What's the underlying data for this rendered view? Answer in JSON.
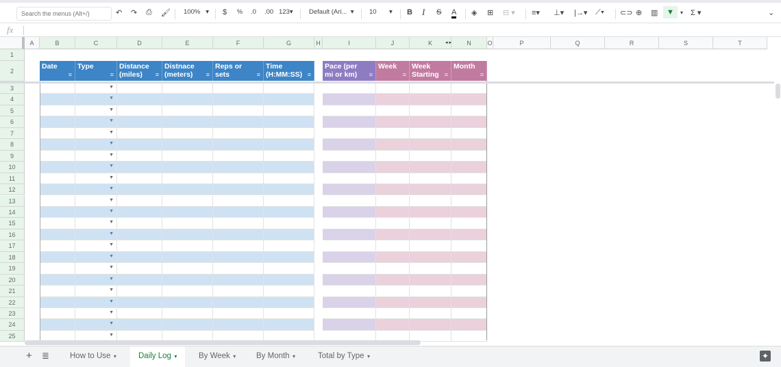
{
  "toolbar": {
    "search_placeholder": "Search the menus (Alt+/)",
    "zoom": "100%",
    "currency": "$",
    "percent": "%",
    "dec_less": ".0",
    "dec_more": ".00",
    "format": "123",
    "font": "Default (Ari...",
    "font_size": "10",
    "bold": "B",
    "italic": "I",
    "strike": "S",
    "text_color": "A",
    "sum": "Σ"
  },
  "formula_bar": {
    "label": "fx",
    "value": ""
  },
  "columns": [
    {
      "letter": "A",
      "w": 22
    },
    {
      "letter": "B",
      "w": 52
    },
    {
      "letter": "C",
      "w": 61
    },
    {
      "letter": "D",
      "w": 66
    },
    {
      "letter": "E",
      "w": 74
    },
    {
      "letter": "F",
      "w": 74
    },
    {
      "letter": "G",
      "w": 74
    },
    {
      "letter": "H",
      "w": 12
    },
    {
      "letter": "I",
      "w": 78
    },
    {
      "letter": "J",
      "w": 49
    },
    {
      "letter": "K",
      "w": 61
    },
    {
      "letter": "N",
      "w": 52
    },
    {
      "letter": "O",
      "w": 9
    },
    {
      "letter": "P",
      "w": 84
    },
    {
      "letter": "Q",
      "w": 79
    },
    {
      "letter": "R",
      "w": 79
    },
    {
      "letter": "S",
      "w": 79
    },
    {
      "letter": "T",
      "w": 79
    }
  ],
  "rows": [
    "1",
    "2",
    "3",
    "4",
    "5",
    "6",
    "7",
    "8",
    "9",
    "10",
    "11",
    "12",
    "13",
    "14",
    "15",
    "16",
    "17",
    "18",
    "19",
    "20",
    "21",
    "22",
    "23",
    "24",
    "25"
  ],
  "headers": [
    {
      "col": "B",
      "line1": "",
      "line2": "Date",
      "group": "blue"
    },
    {
      "col": "C",
      "line1": "",
      "line2": "Type",
      "group": "blue"
    },
    {
      "col": "D",
      "line1": "Distance",
      "line2": "(miles)",
      "group": "blue"
    },
    {
      "col": "E",
      "line1": "Distnace",
      "line2": "(meters)",
      "group": "blue"
    },
    {
      "col": "F",
      "line1": "Reps or",
      "line2": "sets",
      "group": "blue"
    },
    {
      "col": "G",
      "line1": "Time",
      "line2": "(H:MM:SS)",
      "group": "blue"
    },
    {
      "col": "I",
      "line1": "Pace (per",
      "line2": "mi or km)",
      "group": "purple"
    },
    {
      "col": "J",
      "line1": "",
      "line2": "Week",
      "group": "pink"
    },
    {
      "col": "K",
      "line1": "Week",
      "line2": "Starting",
      "group": "pink"
    },
    {
      "col": "N",
      "line1": "",
      "line2": "Month",
      "group": "pink"
    }
  ],
  "colors": {
    "blue": "#3d85c6",
    "blue_light": "#cfe2f3",
    "purple": "#8e7cc3",
    "purple_light": "#d9d2e9",
    "pink": "#c27ba0",
    "pink_light": "#ead1dc",
    "active_tab": "#188038"
  },
  "sheet_tabs": [
    {
      "label": "How to Use",
      "active": false
    },
    {
      "label": "Daily Log",
      "active": true
    },
    {
      "label": "By Week",
      "active": false
    },
    {
      "label": "By Month",
      "active": false
    },
    {
      "label": "Total by Type",
      "active": false
    }
  ]
}
